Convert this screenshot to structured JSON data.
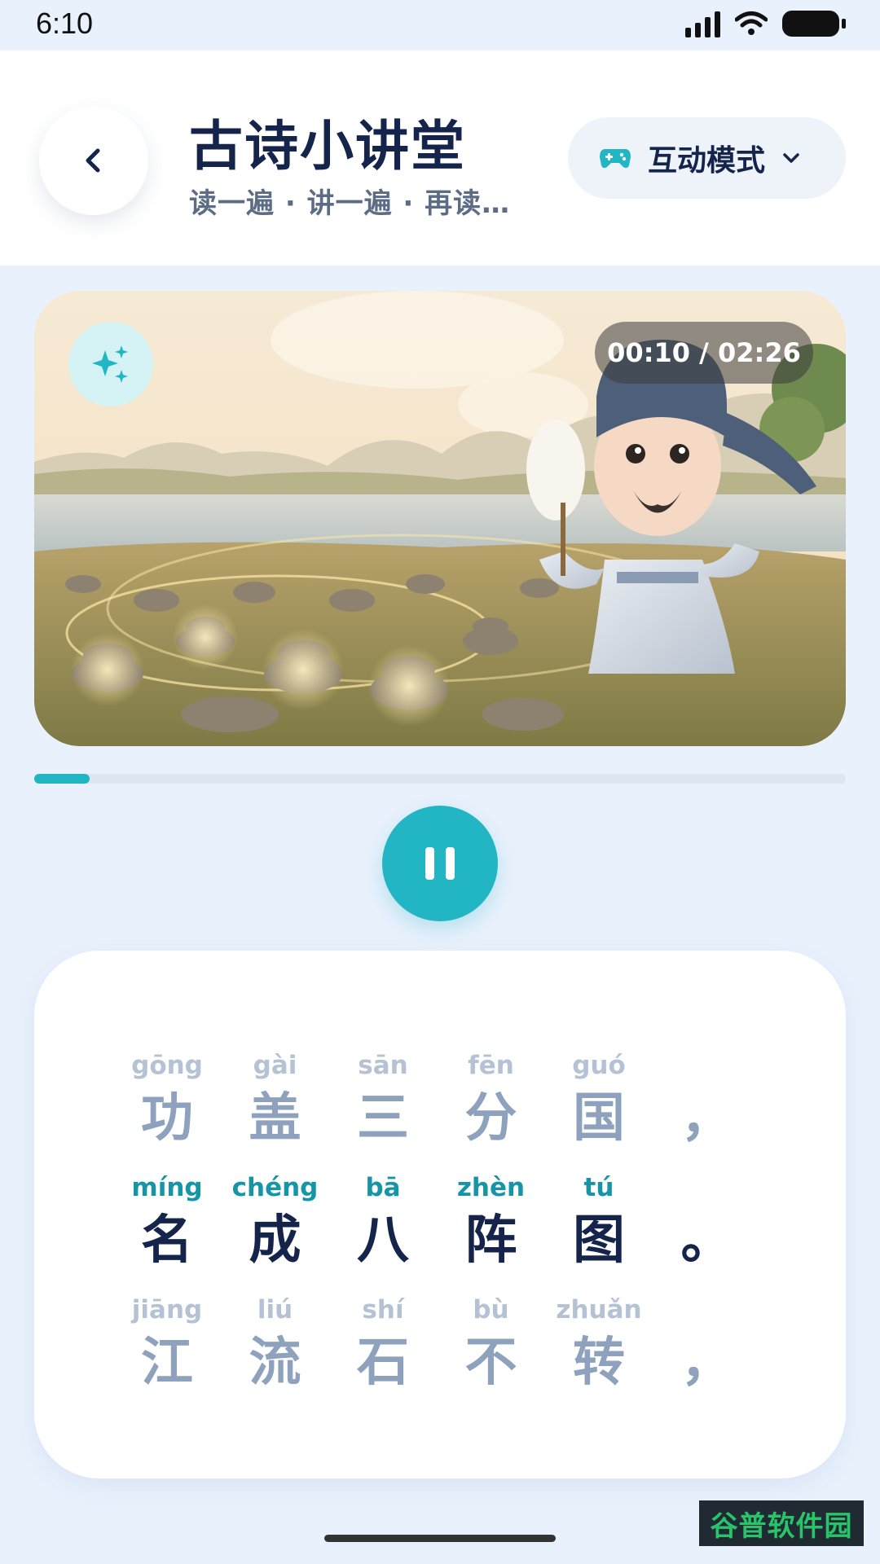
{
  "status_bar": {
    "time": "6:10"
  },
  "header": {
    "title": "古诗小讲堂",
    "subtitle": "读一遍 · 讲一遍 · 再读…",
    "mode_button": {
      "label": "互动模式",
      "icon": "gamepad-icon",
      "chevron": "chevron-down-icon"
    },
    "back_icon": "chevron-left-icon"
  },
  "player": {
    "time_display": "00:10 / 02:26",
    "elapsed": "00:10",
    "duration": "02:26",
    "progress_fraction": 0.068,
    "sparkle_icon": "sparkle-icon",
    "state_icon": "pause-icon"
  },
  "poem": {
    "lines": [
      {
        "state": "dim",
        "chars": [
          {
            "pinyin": "gōng",
            "hanzi": "功"
          },
          {
            "pinyin": "gài",
            "hanzi": "盖"
          },
          {
            "pinyin": "sān",
            "hanzi": "三"
          },
          {
            "pinyin": "fēn",
            "hanzi": "分"
          },
          {
            "pinyin": "guó",
            "hanzi": "国"
          },
          {
            "pinyin": "",
            "hanzi": "，"
          }
        ]
      },
      {
        "state": "active",
        "chars": [
          {
            "pinyin": "míng",
            "hanzi": "名"
          },
          {
            "pinyin": "chéng",
            "hanzi": "成"
          },
          {
            "pinyin": "bā",
            "hanzi": "八"
          },
          {
            "pinyin": "zhèn",
            "hanzi": "阵"
          },
          {
            "pinyin": "tú",
            "hanzi": "图"
          },
          {
            "pinyin": "",
            "hanzi": "。"
          }
        ]
      },
      {
        "state": "dim",
        "chars": [
          {
            "pinyin": "jiāng",
            "hanzi": "江"
          },
          {
            "pinyin": "liú",
            "hanzi": "流"
          },
          {
            "pinyin": "shí",
            "hanzi": "石"
          },
          {
            "pinyin": "bù",
            "hanzi": "不"
          },
          {
            "pinyin": "zhuǎn",
            "hanzi": "转"
          },
          {
            "pinyin": "",
            "hanzi": "，"
          }
        ]
      }
    ]
  },
  "watermark": {
    "text": "谷普软件园"
  },
  "colors": {
    "accent": "#22b5c4",
    "title": "#15244a",
    "background": "#e9f1fd"
  }
}
